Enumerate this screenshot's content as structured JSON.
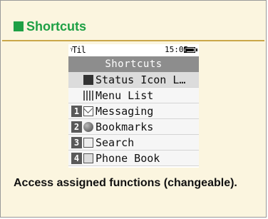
{
  "header": {
    "title": "Shortcuts"
  },
  "phone": {
    "status": {
      "signal": "ᵞTil",
      "time": "15:05"
    },
    "screen_title": "Shortcuts",
    "items": [
      {
        "number": "",
        "icon": "status-icon",
        "label": "Status Icon L…"
      },
      {
        "number": "",
        "icon": "menu-list-icon",
        "label": "Menu List"
      },
      {
        "number": "1",
        "icon": "mail-icon",
        "label": "Messaging"
      },
      {
        "number": "2",
        "icon": "globe-icon",
        "label": "Bookmarks"
      },
      {
        "number": "3",
        "icon": "search-icon",
        "label": "Search"
      },
      {
        "number": "4",
        "icon": "phonebook-icon",
        "label": "Phone Book"
      }
    ]
  },
  "caption": "Access assigned functions (changeable)."
}
